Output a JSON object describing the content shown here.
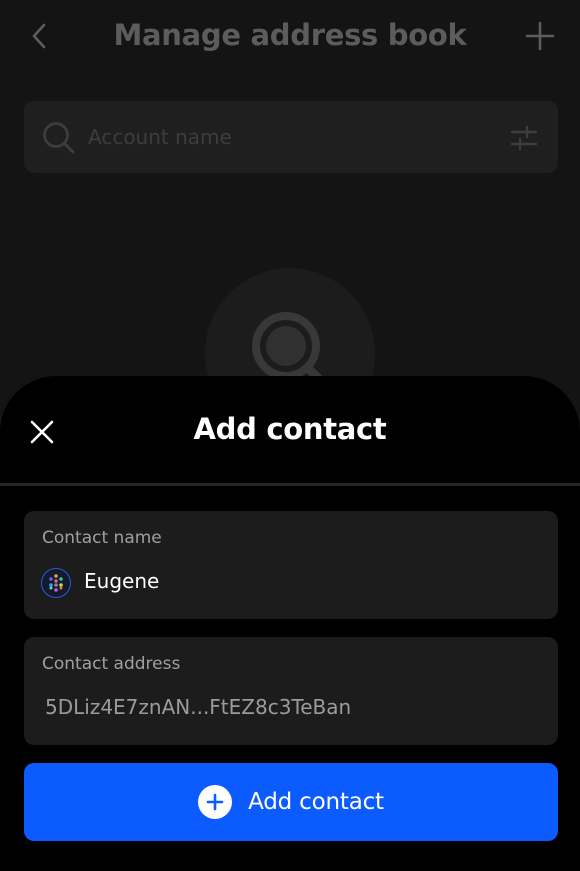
{
  "header": {
    "title": "Manage address book",
    "back_icon": "chevron-left-icon",
    "add_icon": "plus-icon"
  },
  "search": {
    "placeholder": "Account name",
    "value": "",
    "search_icon": "search-icon",
    "filter_icon": "filter-sliders-icon"
  },
  "empty_state": {
    "icon": "search-icon"
  },
  "sheet": {
    "title": "Add contact",
    "close_icon": "close-icon",
    "name_field": {
      "label": "Contact name",
      "value": "Eugene",
      "avatar_icon": "identicon-avatar"
    },
    "address_field": {
      "label": "Contact address",
      "value": "5DLiz4E7znAN...FtEZ8c3TeBan"
    },
    "submit": {
      "label": "Add contact",
      "icon": "plus-circle-icon"
    }
  },
  "colors": {
    "background": "#141414",
    "sheet_background": "#000000",
    "field_background": "#1c1c1c",
    "accent": "#0c5bff",
    "muted_text": "#5c5c5c"
  }
}
